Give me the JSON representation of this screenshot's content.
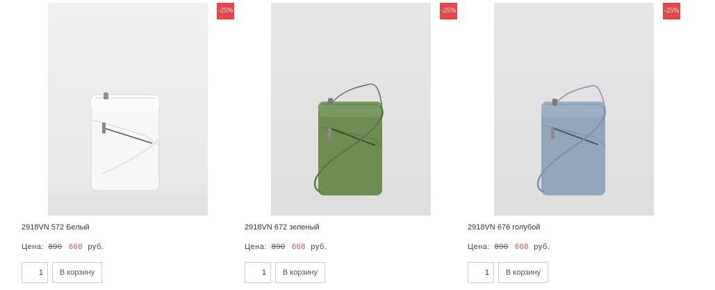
{
  "price_label": "Цена:",
  "currency": "руб.",
  "add_to_cart_label": "В корзину",
  "accent_color": "#e4484b",
  "products": [
    {
      "name": "2918VN 572 Белый",
      "discount": "-25%",
      "old_price": "890",
      "new_price": "668",
      "quantity": "1",
      "color": "#f7f7f7"
    },
    {
      "name": "2918VN 672 зеленый",
      "discount": "-25%",
      "old_price": "890",
      "new_price": "668",
      "quantity": "1",
      "color": "#6f8c52"
    },
    {
      "name": "2918VN 676 голубой",
      "discount": "-25%",
      "old_price": "890",
      "new_price": "668",
      "quantity": "1",
      "color": "#92a6bc"
    }
  ]
}
